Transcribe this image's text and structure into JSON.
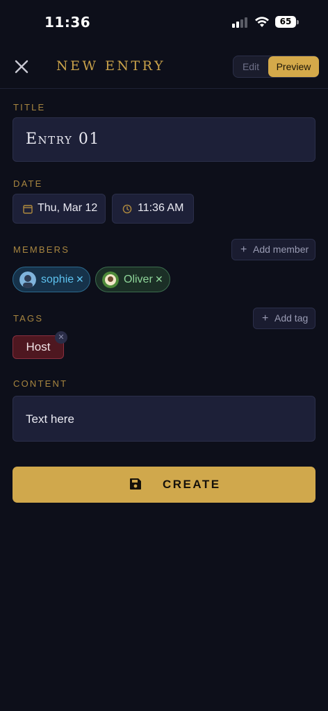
{
  "status_bar": {
    "time": "11:36",
    "battery": "65"
  },
  "header": {
    "title": "NEW ENTRY",
    "toggle": {
      "edit_label": "Edit",
      "preview_label": "Preview",
      "selected": "Preview"
    }
  },
  "form": {
    "title_label": "TITLE",
    "title_value": "Entry 01",
    "date_label": "DATE",
    "date_value": "Thu, Mar 12",
    "time_value": "11:36 AM",
    "members_label": "MEMBERS",
    "add_member_label": "Add member",
    "members": [
      {
        "name": "sophie",
        "color": "#5ec3f0"
      },
      {
        "name": "Oliver",
        "color": "#8fd69a"
      }
    ],
    "tags_label": "TAGS",
    "add_tag_label": "Add tag",
    "tags": [
      {
        "name": "Host",
        "color": "#4e1720"
      }
    ],
    "content_label": "CONTENT",
    "content_value": "Text here"
  },
  "create_button": {
    "label": "CREATE"
  },
  "colors": {
    "accent": "#d0a84c",
    "background": "#0d0f1a",
    "field": "#1d2038"
  },
  "icons": [
    "close-icon",
    "calendar-icon",
    "clock-icon",
    "plus-icon",
    "save-icon",
    "remove-icon"
  ]
}
